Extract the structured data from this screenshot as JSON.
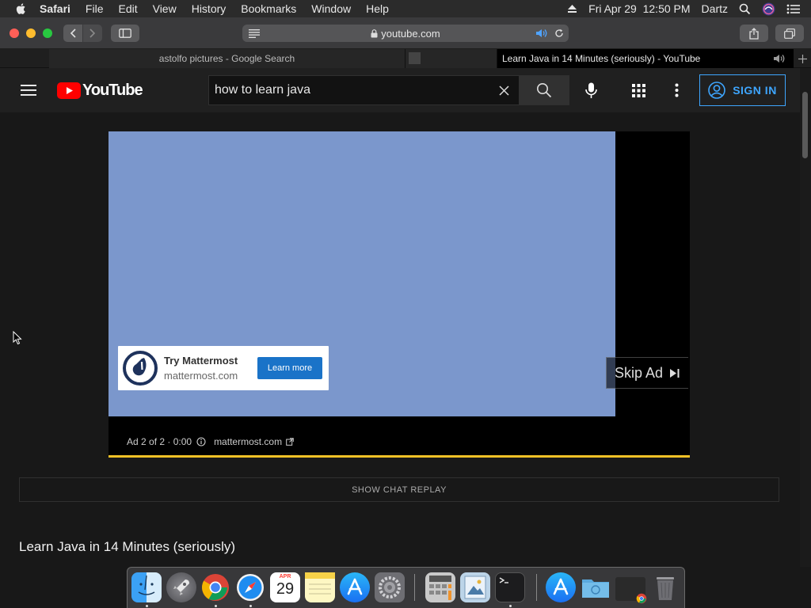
{
  "menubar": {
    "app": "Safari",
    "items": [
      "File",
      "Edit",
      "View",
      "History",
      "Bookmarks",
      "Window",
      "Help"
    ],
    "datetime": "Fri Apr 29  12:50 PM",
    "user": "Dartz"
  },
  "safari": {
    "url": "youtube.com",
    "tabs": [
      {
        "title": "astolfo pictures - Google Search",
        "active": false
      },
      {
        "title": "",
        "active": false
      },
      {
        "title": "Learn Java in 14 Minutes (seriously) - YouTube",
        "active": true
      }
    ]
  },
  "youtube": {
    "logo": "YouTube",
    "search_value": "how to learn java",
    "sign_in_label": "SIGN IN",
    "ad": {
      "title": "Try Mattermost",
      "domain": "mattermost.com",
      "learn_more": "Learn more",
      "skip_label": "Skip Ad",
      "info": "Ad 2 of 2 · 0:00",
      "info_domain": "mattermost.com",
      "progress": 1.0
    },
    "chat_replay": "SHOW CHAT REPLAY",
    "video_title": "Learn Java in 14 Minutes (seriously)"
  },
  "dock": {
    "calendar_month": "APR",
    "calendar_day": "29",
    "apps": [
      "finder-icon",
      "launchpad-icon",
      "chrome-icon",
      "safari-icon",
      "calendar-icon",
      "notes-icon",
      "app-store-icon",
      "system-preferences-icon",
      "calculator-icon",
      "preview-icon",
      "terminal-icon",
      "app-store-folder-icon",
      "downloads-folder-icon",
      "chrome-window-icon",
      "trash-icon"
    ]
  }
}
